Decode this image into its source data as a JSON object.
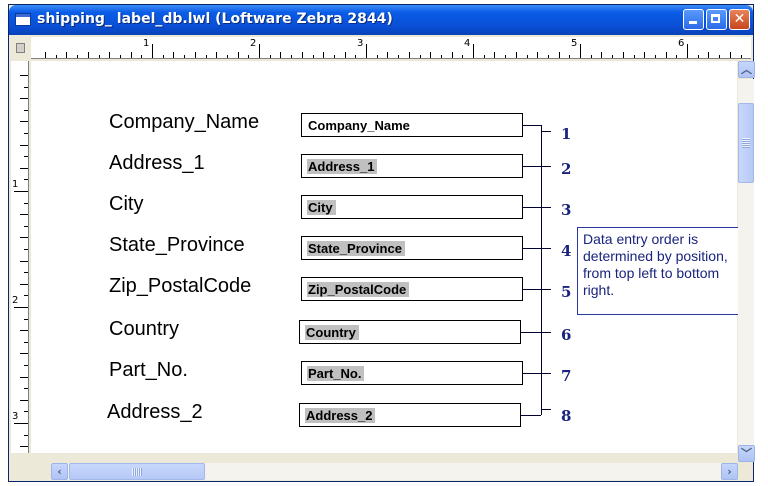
{
  "window": {
    "title": "shipping_ label_db.lwl (Loftware Zebra 2844)"
  },
  "ruler": {
    "horizontal_numbers": [
      "1",
      "2",
      "3",
      "4",
      "5",
      "6"
    ],
    "vertical_numbers": [
      "1",
      "2",
      "3"
    ]
  },
  "fields": [
    {
      "label": "Company_Name",
      "value": "Company_Name",
      "order": "1",
      "highlighted": false
    },
    {
      "label": "Address_1",
      "value": "Address_1",
      "order": "2",
      "highlighted": true
    },
    {
      "label": "City",
      "value": "City",
      "order": "3",
      "highlighted": true
    },
    {
      "label": "State_Province",
      "value": "State_Province",
      "order": "4",
      "highlighted": true
    },
    {
      "label": "Zip_PostalCode",
      "value": "Zip_PostalCode",
      "order": "5",
      "highlighted": true
    },
    {
      "label": "Country",
      "value": "Country",
      "order": "6",
      "highlighted": true
    },
    {
      "label": "Part_No.",
      "value": "Part_No.",
      "order": "7",
      "highlighted": true
    },
    {
      "label": "Address_2",
      "value": "Address_2",
      "order": "8",
      "highlighted": true
    }
  ],
  "note": {
    "text": "Data entry order is determined by position, from top left to bottom right."
  },
  "colors": {
    "titlebar": "#0a4fd6",
    "annotation": "#1a237e",
    "field_highlight": "#c0c0c0"
  },
  "icons": {
    "app": "document-icon",
    "minimize": "minimize-icon",
    "maximize": "maximize-icon",
    "close": "close-icon",
    "scroll_up": "arrow-up-icon",
    "scroll_down": "arrow-down-icon",
    "scroll_left": "arrow-left-icon",
    "scroll_right": "arrow-right-icon"
  }
}
